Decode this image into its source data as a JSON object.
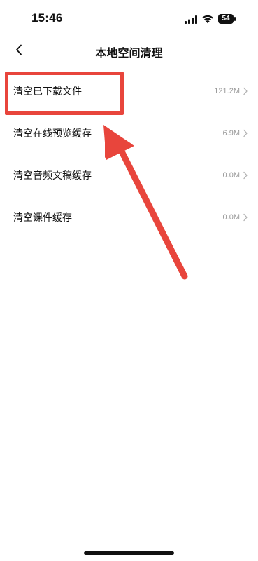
{
  "status_bar": {
    "time": "15:46",
    "battery": "54",
    "signal_icon": "cellular-signal-icon",
    "wifi_icon": "wifi-icon"
  },
  "nav": {
    "back_icon": "chevron-left-icon",
    "title": "本地空间清理"
  },
  "items": [
    {
      "label": "清空已下载文件",
      "value": "121.2M"
    },
    {
      "label": "清空在线预览缓存",
      "value": "6.9M"
    },
    {
      "label": "清空音频文稿缓存",
      "value": "0.0M"
    },
    {
      "label": "清空课件缓存",
      "value": "0.0M"
    }
  ],
  "annotation": {
    "color": "#e8453c",
    "highlighted_item": "清空已下载文件"
  }
}
